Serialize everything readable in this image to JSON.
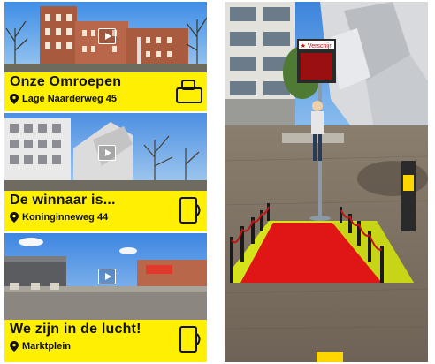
{
  "cards": [
    {
      "title": "Onze Omroepen",
      "address": "Lage Naarderweg 45"
    },
    {
      "title": "De winnaar is...",
      "address": "Koninginneweg 44"
    },
    {
      "title": "We zijn in de lucht!",
      "address": "Marktplein"
    }
  ],
  "ar_scene": {
    "sign_header": "★ Verschijn",
    "sign_text": "Verschijn"
  },
  "colors": {
    "banner_yellow": "#ffef00",
    "carpet_red": "#e01515",
    "sky_blue": "#4a8de0"
  },
  "icons": [
    "map-pin-icon",
    "phone-rotate-icon",
    "play-icon"
  ]
}
